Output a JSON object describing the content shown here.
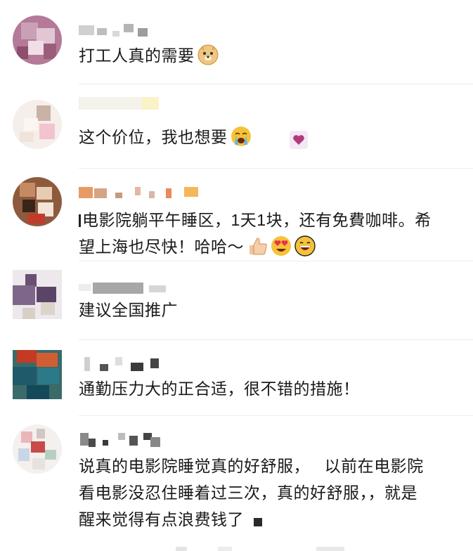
{
  "comments": [
    {
      "text": "打工人真的需要",
      "emojis": [
        "doge-icon"
      ]
    },
    {
      "text": "这个价位，我也想要",
      "emojis": [
        "crying-face-icon"
      ]
    },
    {
      "line1": "电影院躺平午睡区，1天1块，还有免費咖啡。希",
      "line2": "望上海也尽快！哈哈～",
      "emojis": [
        "thumbs-up-icon",
        "heart-eyes-icon",
        "grinning-face-icon"
      ]
    },
    {
      "text": "建议全国推广"
    },
    {
      "text": "通勤压力大的正合适，很不错的措施！"
    },
    {
      "line1": "说真的电影院睡觉真的好舒服，   以前在电影院",
      "line2": "看电影没忍住睡着过三次，真的好舒服，，就是",
      "line3": "醒来觉得有点浪费钱了"
    }
  ],
  "colors": {
    "divider": "#ececec",
    "text": "#1a1a1a",
    "emoji_yellow": "#f6c23a"
  }
}
